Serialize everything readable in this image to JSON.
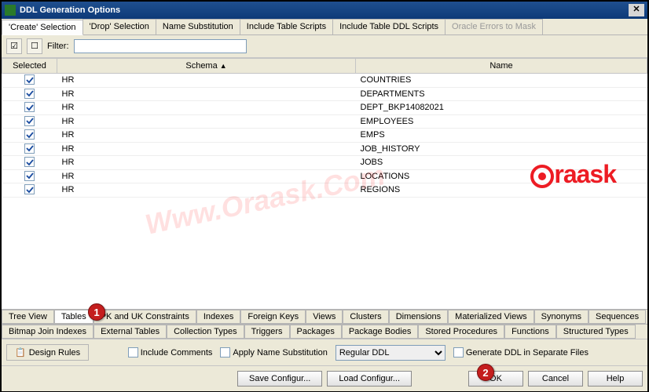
{
  "window": {
    "title": "DDL Generation Options"
  },
  "topTabs": {
    "t0": "'Create' Selection",
    "t1": "'Drop' Selection",
    "t2": "Name Substitution",
    "t3": "Include Table Scripts",
    "t4": "Include Table DDL Scripts",
    "t5": "Oracle Errors to Mask"
  },
  "toolbar": {
    "filterLabel": "Filter:",
    "filterValue": ""
  },
  "columns": {
    "selected": "Selected",
    "schema": "Schema",
    "name": "Name"
  },
  "rows": [
    {
      "schema": "HR",
      "name": "COUNTRIES"
    },
    {
      "schema": "HR",
      "name": "DEPARTMENTS"
    },
    {
      "schema": "HR",
      "name": "DEPT_BKP14082021"
    },
    {
      "schema": "HR",
      "name": "EMPLOYEES"
    },
    {
      "schema": "HR",
      "name": "EMPS"
    },
    {
      "schema": "HR",
      "name": "JOB_HISTORY"
    },
    {
      "schema": "HR",
      "name": "JOBS"
    },
    {
      "schema": "HR",
      "name": "LOCATIONS"
    },
    {
      "schema": "HR",
      "name": "REGIONS"
    }
  ],
  "bottomTabs": {
    "r1": {
      "b0": "Tree View",
      "b1": "Tables",
      "b2": "PK and UK Constraints",
      "b3": "Indexes",
      "b4": "Foreign Keys",
      "b5": "Views",
      "b6": "Clusters",
      "b7": "Dimensions",
      "b8": "Materialized Views",
      "b9": "Synonyms",
      "b10": "Sequences"
    },
    "r2": {
      "b0": "Bitmap Join Indexes",
      "b1": "External Tables",
      "b2": "Collection Types",
      "b3": "Triggers",
      "b4": "Packages",
      "b5": "Package Bodies",
      "b6": "Stored Procedures",
      "b7": "Functions",
      "b8": "Structured Types"
    }
  },
  "options": {
    "designRules": "Design Rules",
    "includeComments": "Include Comments",
    "applyNameSub": "Apply Name Substitution",
    "ddlType": "Regular DDL",
    "genSeparate": "Generate DDL in Separate Files"
  },
  "buttons": {
    "saveConfig": "Save Configur...",
    "loadConfig": "Load Configur...",
    "ok": "OK",
    "cancel": "Cancel",
    "help": "Help"
  },
  "callouts": {
    "c1": "1",
    "c2": "2"
  },
  "watermark": "Www.Oraask.Com",
  "brand": "raask"
}
